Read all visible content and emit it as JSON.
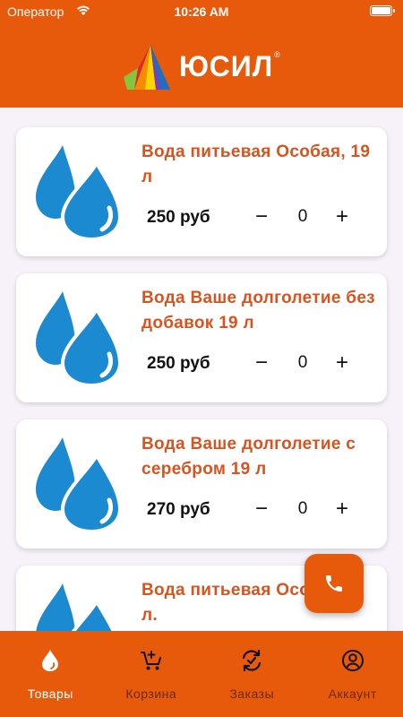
{
  "status_bar": {
    "carrier": "Оператор",
    "time": "10:26 AM"
  },
  "header": {
    "logo_text": "ЮСИЛ",
    "logo_mark": "®"
  },
  "products": [
    {
      "title": "Вода питьевая Особая, 19 л",
      "price": "250 руб",
      "minus": "−",
      "quantity": "0",
      "plus": "+",
      "icon": "water-drops-icon"
    },
    {
      "title": "Вода Ваше долголетие без добавок 19 л",
      "price": "250 руб",
      "minus": "−",
      "quantity": "0",
      "plus": "+",
      "icon": "water-drops-icon"
    },
    {
      "title": "Вода Ваше долголетие с серебром 19 л",
      "price": "270 руб",
      "minus": "−",
      "quantity": "0",
      "plus": "+",
      "icon": "water-drops-icon"
    },
    {
      "title": "Вода питьевая Особая, 5 л.",
      "price": "",
      "minus": "",
      "quantity": "",
      "plus": "",
      "icon": "water-drops-icon"
    }
  ],
  "fab": {
    "icon": "phone-icon"
  },
  "tabs": [
    {
      "label": "Товары",
      "icon": "water-drop-icon",
      "active": true
    },
    {
      "label": "Корзина",
      "icon": "cart-add-icon",
      "active": false
    },
    {
      "label": "Заказы",
      "icon": "orders-icon",
      "active": false
    },
    {
      "label": "Аккаунт",
      "icon": "account-icon",
      "active": false
    }
  ],
  "colors": {
    "brand": "#e75a0c",
    "title": "#d9531f",
    "drop": "#1c8ad0",
    "background": "#f7f2fa"
  }
}
